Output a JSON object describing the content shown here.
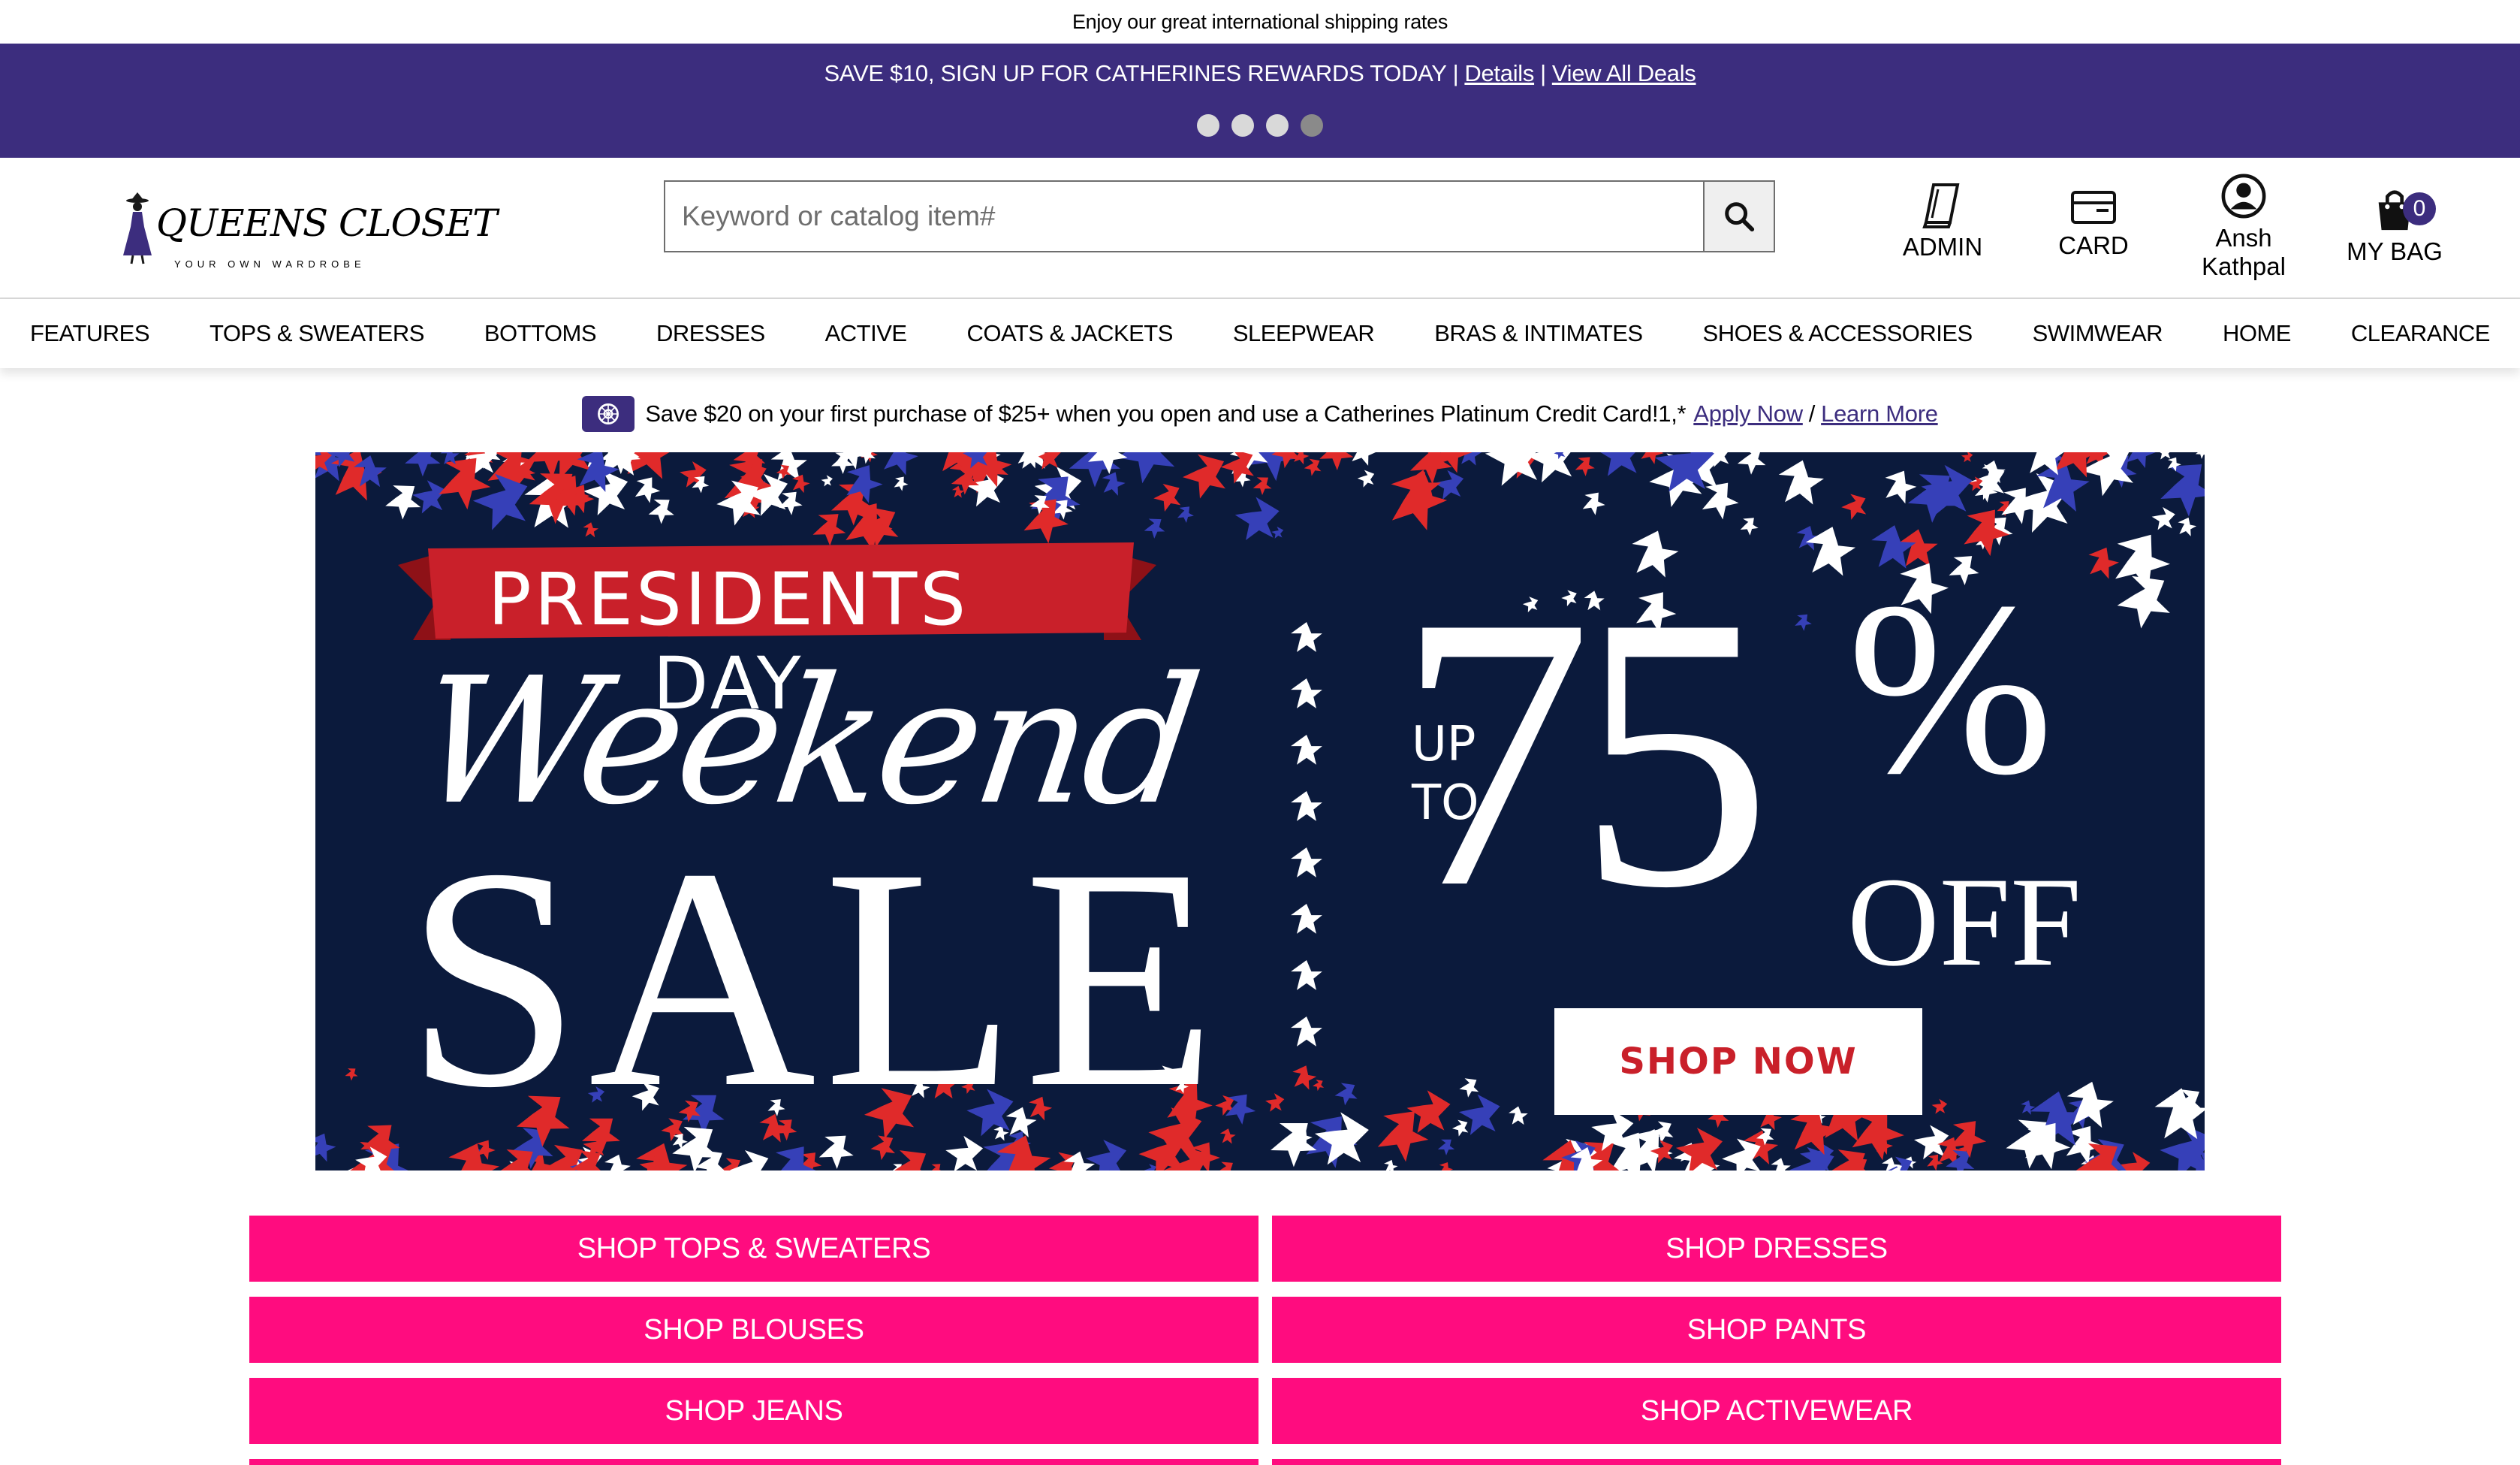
{
  "announcement": "Enjoy our great international shipping rates",
  "deals_bar": {
    "message": "SAVE $10, SIGN UP FOR CATHERINES REWARDS TODAY",
    "separator": "|",
    "details_link": "Details",
    "view_all_link": "View All Deals",
    "slides": 4,
    "active_slide": 4
  },
  "logo": {
    "name": "QUEENS CLOSET",
    "tagline": "YOUR OWN WARDROBE"
  },
  "search": {
    "placeholder": "Keyword or catalog item#"
  },
  "utility": {
    "admin": "ADMIN",
    "card": "CARD",
    "user_first": "Ansh",
    "user_last": "Kathpal",
    "bag": "MY BAG",
    "bag_count": "0"
  },
  "nav": [
    "FEATURES",
    "TOPS & SWEATERS",
    "BOTTOMS",
    "DRESSES",
    "ACTIVE",
    "COATS & JACKETS",
    "SLEEPWEAR",
    "BRAS & INTIMATES",
    "SHOES & ACCESSORIES",
    "SWIMWEAR",
    "HOME",
    "CLEARANCE"
  ],
  "promo": {
    "text": "Save $20 on your first purchase of $25+ when you open and use a Catherines Platinum Credit Card!1,*",
    "apply_link": "Apply Now",
    "separator": "/",
    "learn_link": "Learn More"
  },
  "hero": {
    "ribbon": "PRESIDENTS DAY",
    "script": "Weekend",
    "headline": "SALE",
    "up_to": "UP",
    "to": "TO",
    "discount": "75",
    "percent": "%",
    "off": "OFF",
    "cta": "SHOP NOW"
  },
  "categories": [
    "SHOP TOPS & SWEATERS",
    "SHOP DRESSES",
    "SHOP BLOUSES",
    "SHOP PANTS",
    "SHOP JEANS",
    "SHOP ACTIVEWEAR"
  ],
  "colors": {
    "brand_purple": "#3c2d7e",
    "category_pink": "#ff0c7f",
    "hero_navy": "#0b1a3c",
    "ribbon_red": "#c9202a"
  }
}
